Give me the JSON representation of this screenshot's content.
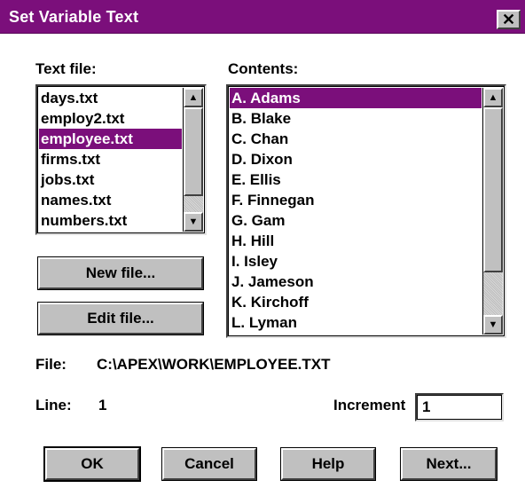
{
  "window": {
    "title": "Set Variable Text"
  },
  "text_file": {
    "label": "Text file:",
    "items": [
      "days.txt",
      "employ2.txt",
      "employee.txt",
      "firms.txt",
      "jobs.txt",
      "names.txt",
      "numbers.txt"
    ],
    "selected_index": 2
  },
  "contents": {
    "label": "Contents:",
    "items": [
      "A. Adams",
      "B. Blake",
      "C. Chan",
      "D. Dixon",
      "E. Ellis",
      "F. Finnegan",
      "G. Gam",
      "H. Hill",
      "I. Isley",
      "J. Jameson",
      "K. Kirchoff",
      "L. Lyman"
    ],
    "selected_index": 0
  },
  "buttons": {
    "new_file": "New file...",
    "edit_file": "Edit file...",
    "ok": "OK",
    "cancel": "Cancel",
    "help": "Help",
    "next": "Next..."
  },
  "file_info": {
    "label": "File:",
    "path": "C:\\APEX\\WORK\\EMPLOYEE.TXT"
  },
  "line_info": {
    "label": "Line:",
    "value": "1"
  },
  "increment": {
    "label": "Increment",
    "value": "1"
  },
  "colors": {
    "accent": "#7b0f7b",
    "face": "#c0c0c0"
  },
  "icons": {
    "close": "close-icon",
    "scroll_up": "arrow-up-icon",
    "scroll_down": "arrow-down-icon"
  }
}
